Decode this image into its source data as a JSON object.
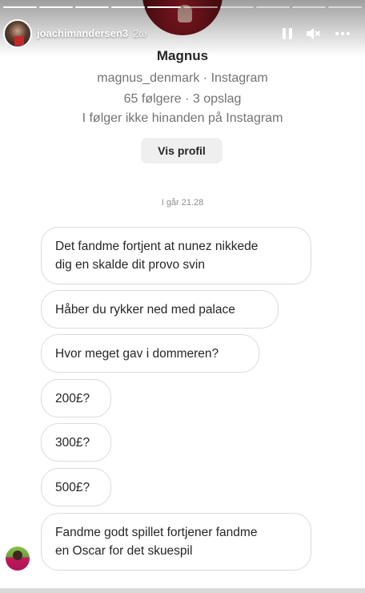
{
  "story": {
    "progress_segments": 10,
    "progress_viewed": 5,
    "poster_username": "joachimandersen3",
    "time_ago": "2ω",
    "pause_icon": "pause-icon",
    "mute_icon": "speaker-muted-icon",
    "more_icon": "more-dots-icon"
  },
  "profile": {
    "name": "Magnus",
    "handle_line": "magnus_denmark · Instagram",
    "stats_line": "65 følgere · 3 opslag",
    "relation_line": "I følger ikke hinanden på Instagram",
    "view_profile_label": "Vis profil"
  },
  "conversation": {
    "timestamp": "I går 21.28",
    "messages": [
      {
        "line1": "Det fandme fortjent at nunez nikkede",
        "line2": "dig en skalde dit provo svin"
      },
      {
        "line1": "Håber du rykker ned med palace"
      },
      {
        "line1": "Hvor meget gav i dommeren?"
      },
      {
        "line1": "200£?"
      },
      {
        "line1": "300£?"
      },
      {
        "line1": "500£?"
      },
      {
        "line1": "Fandme godt spillet fortjener fandme",
        "line2": "en Oscar for det skuespil"
      }
    ]
  },
  "colors": {
    "bubble_border": "#dbdbdb",
    "secondary_text": "#737373",
    "button_bg": "#efefef"
  }
}
